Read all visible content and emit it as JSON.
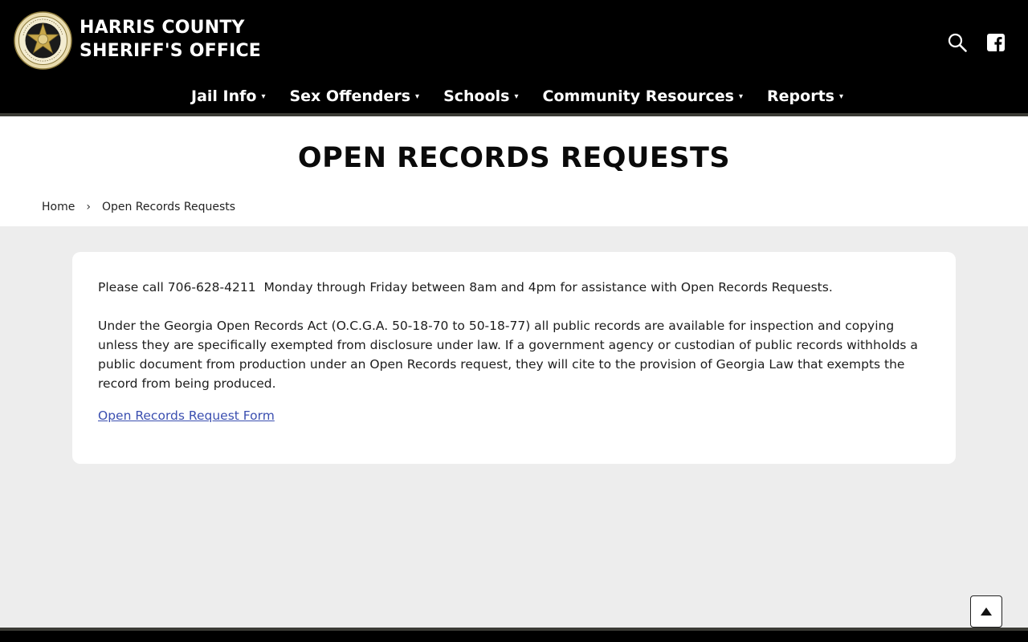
{
  "site": {
    "title_line1": "HARRIS COUNTY",
    "title_line2": "SHERIFF'S OFFICE",
    "logo_icon": "sheriff-star-badge-logo",
    "header_bg": "#000000",
    "accent_gold": "#c8a84a"
  },
  "header_icons": {
    "search": "search-icon",
    "social": "facebook-icon"
  },
  "nav": [
    {
      "label": "Jail Info",
      "caret": "▾"
    },
    {
      "label": "Sex Offenders",
      "caret": "▾"
    },
    {
      "label": "Schools",
      "caret": "▾"
    },
    {
      "label": "Community Resources",
      "caret": "▾"
    },
    {
      "label": "Reports",
      "caret": "▾"
    }
  ],
  "page": {
    "title": "OPEN RECORDS REQUESTS",
    "breadcrumb": [
      {
        "label": "Home"
      },
      {
        "label": "Open Records Requests"
      }
    ],
    "breadcrumb_separator": "›"
  },
  "content": {
    "paragraph1": "Please call 706-628-4211  Monday through Friday between 8am and 4pm for assistance with Open Records Requests.",
    "paragraph2": "Under the Georgia Open Records Act (O.C.G.A. 50-18-70 to 50-18-77) all public records are available for inspection and copying unless they are specifically exempted from disclosure under law. If a government agency or custodian of public records withholds a public document from production under an Open Records request, they will cite to the provision of Georgia Law that exempts the record from being produced.",
    "link_label": "Open Records Request Form",
    "link_color": "#3b4fb0"
  },
  "back_to_top": {
    "icon": "arrow-up-icon"
  }
}
